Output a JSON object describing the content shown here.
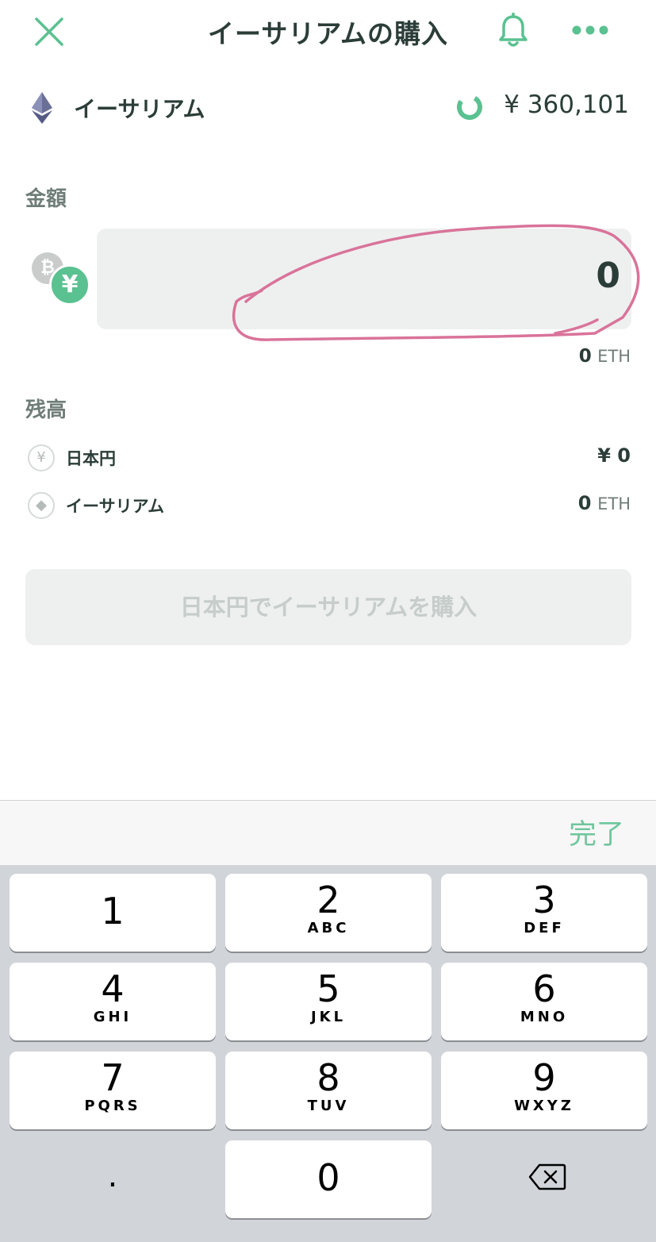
{
  "header": {
    "title": "イーサリアムの購入",
    "close_icon": "close-icon",
    "bell_icon": "bell-icon",
    "more_icon": "more-icon"
  },
  "asset": {
    "name": "イーサリアム",
    "price": "¥ 360,101",
    "logo_icon": "ethereum-icon",
    "refresh_icon": "refresh-icon"
  },
  "amount": {
    "label": "金額",
    "value": "0",
    "eth_equiv_value": "0",
    "eth_equiv_unit": "ETH",
    "currency_icons": {
      "crypto": "₿",
      "fiat": "¥"
    }
  },
  "balance": {
    "label": "残高",
    "items": [
      {
        "name": "日本円",
        "icon_glyph": "¥",
        "value": "¥ 0",
        "unit": ""
      },
      {
        "name": "イーサリアム",
        "icon_glyph": "◆",
        "value": "0",
        "unit": "ETH"
      }
    ]
  },
  "buy_button": {
    "label": "日本円でイーサリアムを購入"
  },
  "keyboard": {
    "done_label": "完了",
    "keys": [
      {
        "digit": "1",
        "letters": ""
      },
      {
        "digit": "2",
        "letters": "ABC"
      },
      {
        "digit": "3",
        "letters": "DEF"
      },
      {
        "digit": "4",
        "letters": "GHI"
      },
      {
        "digit": "5",
        "letters": "JKL"
      },
      {
        "digit": "6",
        "letters": "MNO"
      },
      {
        "digit": "7",
        "letters": "PQRS"
      },
      {
        "digit": "8",
        "letters": "TUV"
      },
      {
        "digit": "9",
        "letters": "WXYZ"
      },
      {
        "digit": ".",
        "letters": ""
      },
      {
        "digit": "0",
        "letters": ""
      }
    ],
    "backspace_icon": "backspace-icon"
  },
  "colors": {
    "accent": "#5ac190",
    "text": "#2b3d38",
    "muted": "#6f7d79",
    "annotation": "#d9739a",
    "field_bg": "#eef0ef"
  }
}
